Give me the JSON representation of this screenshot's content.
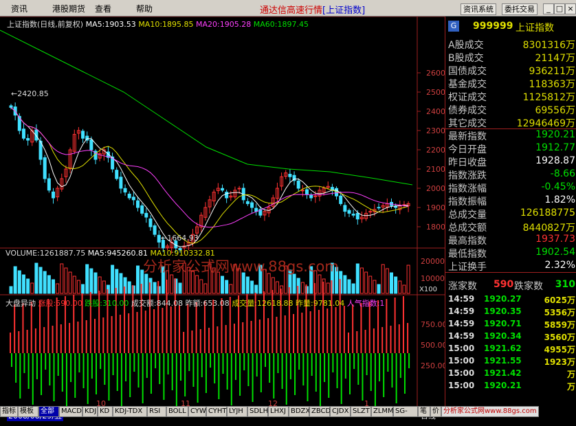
{
  "menu": {
    "items": [
      "资讯",
      "港股期货",
      "查看",
      "帮助"
    ],
    "title_main": "通达信高速行情",
    "title_sub": "[上证指数]",
    "btn_info": "资讯系统",
    "btn_trade": "委托交易",
    "ctrl_min": "_",
    "ctrl_max": "□",
    "ctrl_close": "×"
  },
  "chart": {
    "title": "上证指数(日线,前复权)",
    "ma5": "MA5:1903.53",
    "ma10": "MA10:1895.85",
    "ma20": "MA20:1905.28",
    "ma60": "MA60:1897.45",
    "high_label": "2420.85",
    "low_label": "1664.93",
    "price_ticks": [
      "2600",
      "2500",
      "2400",
      "2300",
      "2200",
      "2100",
      "2000",
      "1900",
      "1800"
    ],
    "volume_label": "VOLUME:1261887.75",
    "vol_ma5": "MA5:945260.81",
    "vol_ma10": "MA10:910332.81",
    "vol_ticks": [
      "20000",
      "10000",
      "X100"
    ],
    "watermark": "分析家公式网www.88gs.com",
    "adl_title": "大盘异动",
    "adl_up": "涨股:590.00",
    "adl_down": "跌股:310.00",
    "adl_amount": "成交额:844.08",
    "adl_prev": "昨额:653.08",
    "adl_vol": "成交量:12618.88",
    "adl_prev_vol": "昨量:9781.04",
    "adl_pop": "人气指数:1",
    "adl_ticks": [
      "750.00",
      "500.00",
      "250.00"
    ],
    "date_label": "2008/08/29/五",
    "months": [
      "10",
      "11",
      "12",
      "1"
    ],
    "period": "日线",
    "colors": {
      "up": "#ff3232",
      "down": "#00e000",
      "ma5": "#ffffff",
      "ma10": "#e0e000",
      "ma20": "#ff40ff",
      "ma60": "#00e000",
      "axis": "#a02020"
    }
  },
  "panel": {
    "code": "999999",
    "name": "上证指数",
    "g_icon": "G",
    "stats": [
      {
        "label": "A股成交",
        "value": "8301316万",
        "color": "#e0e000"
      },
      {
        "label": "B股成交",
        "value": "21147万",
        "color": "#e0e000"
      },
      {
        "label": "国债成交",
        "value": "936211万",
        "color": "#e0e000"
      },
      {
        "label": "基金成交",
        "value": "118363万",
        "color": "#e0e000"
      },
      {
        "label": "权证成交",
        "value": "1125812万",
        "color": "#e0e000"
      },
      {
        "label": "债券成交",
        "value": "69556万",
        "color": "#e0e000"
      },
      {
        "label": "其它成交",
        "value": "12946469万",
        "color": "#e0e000"
      },
      {
        "label": "最新指数",
        "value": "1920.21",
        "color": "#00e000"
      },
      {
        "label": "今日开盘",
        "value": "1912.77",
        "color": "#00e000"
      },
      {
        "label": "昨日收盘",
        "value": "1928.87",
        "color": "#ffffff"
      },
      {
        "label": "指数涨跌",
        "value": "-8.66",
        "color": "#00e000"
      },
      {
        "label": "指数涨幅",
        "value": "-0.45%",
        "color": "#00e000"
      },
      {
        "label": "指数振幅",
        "value": "1.82%",
        "color": "#ffffff"
      },
      {
        "label": "总成交量",
        "value": "126188775",
        "color": "#e0e000"
      },
      {
        "label": "总成交额",
        "value": "8440827万",
        "color": "#e0e000"
      },
      {
        "label": "最高指数",
        "value": "1937.73",
        "color": "#ff3232"
      },
      {
        "label": "最低指数",
        "value": "1902.54",
        "color": "#00e000"
      },
      {
        "label": "上证换手",
        "value": "2.32%",
        "color": "#ffffff"
      }
    ],
    "up_label": "涨家数",
    "up_count": "590",
    "down_label": "跌家数",
    "down_count": "310",
    "ticks": [
      {
        "time": "14:59",
        "price": "1920.27",
        "vol": "6025万"
      },
      {
        "time": "14:59",
        "price": "1920.35",
        "vol": "5356万"
      },
      {
        "time": "14:59",
        "price": "1920.71",
        "vol": "5859万"
      },
      {
        "time": "14:59",
        "price": "1920.34",
        "vol": "3560万"
      },
      {
        "time": "15:00",
        "price": "1921.62",
        "vol": "4955万"
      },
      {
        "time": "15:00",
        "price": "1921.55",
        "vol": "1923万"
      },
      {
        "time": "15:00",
        "price": "1921.42",
        "vol": "万"
      },
      {
        "time": "15:00",
        "price": "1920.21",
        "vol": "万"
      }
    ]
  },
  "tabs": [
    "指标",
    "模板",
    "全部",
    "MACD",
    "KDJ",
    "KD",
    "KDJ-TDX",
    "RSI",
    "BOLL",
    "CYW",
    "CYHT",
    "LYJH",
    "SDLH",
    "LHXJ",
    "BDZX",
    "ZBCD",
    "CJDX",
    "SLZT",
    "ZLMM",
    "SG-LB",
    "笔",
    "价"
  ],
  "footer_watermark": "分析家公式网www.88gs.com"
}
